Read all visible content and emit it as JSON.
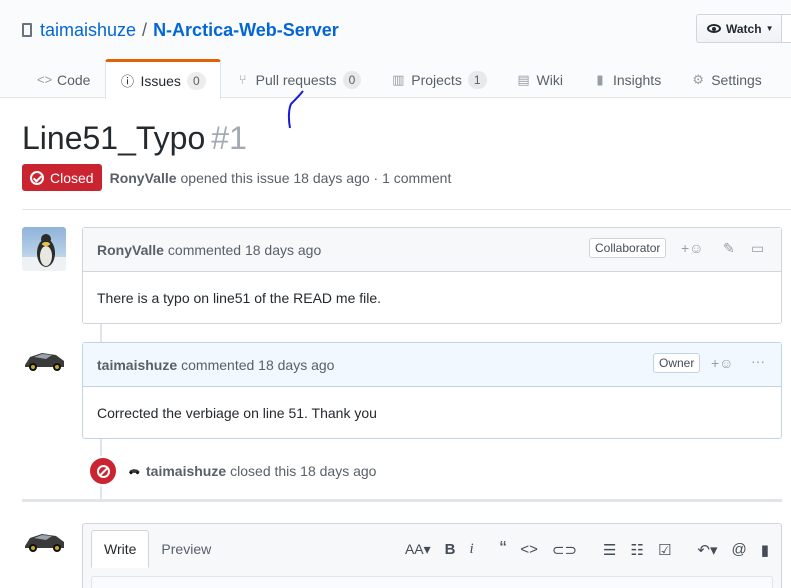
{
  "repo": {
    "owner": "taimaishuze",
    "separator": "/",
    "name": "N-Arctica-Web-Server"
  },
  "watch": {
    "label": "Watch",
    "icon": "eye-icon"
  },
  "tabs": [
    {
      "label": "Code",
      "icon": "code-icon",
      "counter": null
    },
    {
      "label": "Issues",
      "icon": "issue-icon",
      "counter": "0"
    },
    {
      "label": "Pull requests",
      "icon": "pull-request-icon",
      "counter": "0"
    },
    {
      "label": "Projects",
      "icon": "project-icon",
      "counter": "1"
    },
    {
      "label": "Wiki",
      "icon": "book-icon",
      "counter": null
    },
    {
      "label": "Insights",
      "icon": "graph-icon",
      "counter": null
    },
    {
      "label": "Settings",
      "icon": "gear-icon",
      "counter": null
    }
  ],
  "issue": {
    "title": "Line51_Typo",
    "number": "#1",
    "state": "Closed",
    "author": "RonyValle",
    "meta": "opened this issue 18 days ago · 1 comment"
  },
  "comments": [
    {
      "author": "RonyValle",
      "action": "commented 18 days ago",
      "role": "Collaborator",
      "body": "There is a typo on line51 of the READ me file."
    },
    {
      "author": "taimaishuze",
      "action": "commented 18 days ago",
      "role": "Owner",
      "body": "Corrected the verbiage on line 51. Thank you"
    }
  ],
  "close_event": {
    "author": "taimaishuze",
    "action": "closed this 18 days ago"
  },
  "composer": {
    "tabs": [
      "Write",
      "Preview"
    ],
    "toolbar": [
      "AA",
      "B",
      "i",
      "“",
      "<>",
      "link",
      "ul",
      "ol",
      "task",
      "reply",
      "@",
      "bookmark"
    ]
  },
  "colors": {
    "closed": "#cb2431",
    "link": "#0366d6",
    "tab_accent": "#e36209",
    "owner_header": "#f1f8ff"
  }
}
